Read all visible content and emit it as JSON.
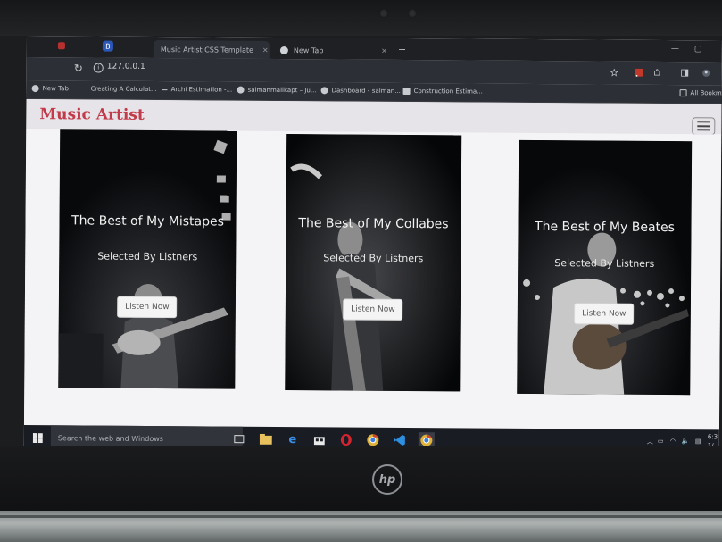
{
  "browser": {
    "tabs": [
      {
        "title": "Music Artist CSS Template",
        "active": true
      },
      {
        "title": "New Tab",
        "active": false
      }
    ],
    "address": "127.0.0.1",
    "bookmarks": [
      {
        "label": "New Tab"
      },
      {
        "label": "Creating A Calculat..."
      },
      {
        "label": "Archi Estimation -..."
      },
      {
        "label": "salmanmalikapt – Ju..."
      },
      {
        "label": "Dashboard ‹ salman..."
      },
      {
        "label": "Construction Estima..."
      }
    ],
    "other_bookmarks": "All Bookmarks"
  },
  "page": {
    "site_title": "Music Artist",
    "cards": [
      {
        "title": "The Best of My Mistapes",
        "subtitle": "Selected By Listners",
        "button": "Listen Now"
      },
      {
        "title": "The Best of My Collabes",
        "subtitle": "Selected By Listners",
        "button": "Listen Now"
      },
      {
        "title": "The Best of My Beates",
        "subtitle": "Selected By Listners",
        "button": "Listen Now"
      }
    ]
  },
  "taskbar": {
    "search_placeholder": "Search the web and Windows",
    "time": "6:3",
    "date": "1/"
  },
  "colors": {
    "site_title": "#c33a4a",
    "card_background": "#0c0d10",
    "taskbar": "#1a1c24"
  },
  "laptop_brand": "hp"
}
